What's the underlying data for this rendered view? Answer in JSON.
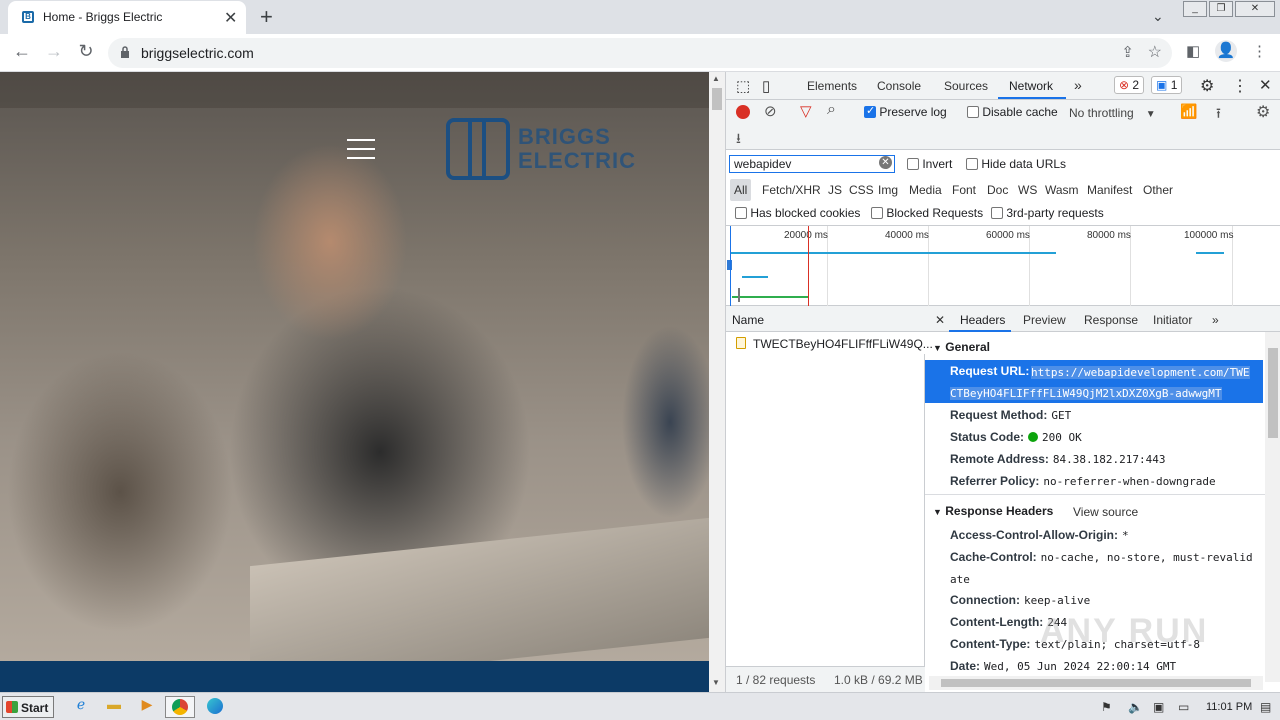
{
  "browser": {
    "tab_title": "Home - Briggs Electric",
    "tab_close": "✕",
    "new_tab": "+",
    "tab_menu": "⌄",
    "url": "briggselectric.com"
  },
  "website": {
    "logo_line1": "BRIGGS",
    "logo_line2": "ELECTRIC"
  },
  "devtools": {
    "tabs": [
      "Elements",
      "Console",
      "Sources",
      "Network"
    ],
    "more_tabs": "»",
    "error_count": "2",
    "message_count": "1",
    "preserve_log": "Preserve log",
    "disable_cache": "Disable cache",
    "throttling": "No throttling",
    "filter_value": "webapidev",
    "invert": "Invert",
    "hide_data_urls": "Hide data URLs",
    "filter_types": [
      "All",
      "Fetch/XHR",
      "JS",
      "CSS",
      "Img",
      "Media",
      "Font",
      "Doc",
      "WS",
      "Wasm",
      "Manifest",
      "Other"
    ],
    "has_blocked_cookies": "Has blocked cookies",
    "blocked_requests": "Blocked Requests",
    "third_party": "3rd-party requests",
    "timeline_labels": [
      "20000 ms",
      "40000 ms",
      "60000 ms",
      "80000 ms",
      "100000 ms"
    ],
    "name_header": "Name",
    "request_name": "TWECTBeyHO4FLIFffFLiW49Q...",
    "status_requests": "1 / 82 requests",
    "status_transfer": "1.0 kB / 69.2 MB",
    "detail_tabs": [
      "Headers",
      "Preview",
      "Response",
      "Initiator"
    ],
    "detail_close": "✕",
    "detail_more": "»",
    "general_heading": "General",
    "request_url_key": "Request URL:",
    "request_url_line1": "https://webapidevelopment.com/TWE",
    "request_url_line2": "CTBeyHO4FLIFffFLiW49QjM2lxDXZ0XgB-adwwgMT",
    "request_method_key": "Request Method:",
    "request_method_val": "GET",
    "status_code_key": "Status Code:",
    "status_code_val": "200 OK",
    "remote_address_key": "Remote Address:",
    "remote_address_val": "84.38.182.217:443",
    "referrer_policy_key": "Referrer Policy:",
    "referrer_policy_val": "no-referrer-when-downgrade",
    "response_headers_heading": "Response Headers",
    "view_source": "View source",
    "acao_key": "Access-Control-Allow-Origin:",
    "acao_val": "*",
    "cache_control_key": "Cache-Control:",
    "cache_control_val1": "no-cache, no-store, must-revalid",
    "cache_control_val2": "ate",
    "connection_key": "Connection:",
    "connection_val": "keep-alive",
    "content_length_key": "Content-Length:",
    "content_length_val": "244",
    "content_type_key": "Content-Type:",
    "content_type_val": "text/plain; charset=utf-8",
    "date_key": "Date:",
    "date_val": "Wed, 05 Jun 2024 22:00:14 GMT"
  },
  "watermark": "ANY RUN",
  "taskbar": {
    "start": "Start",
    "clock": "11:01 PM"
  }
}
